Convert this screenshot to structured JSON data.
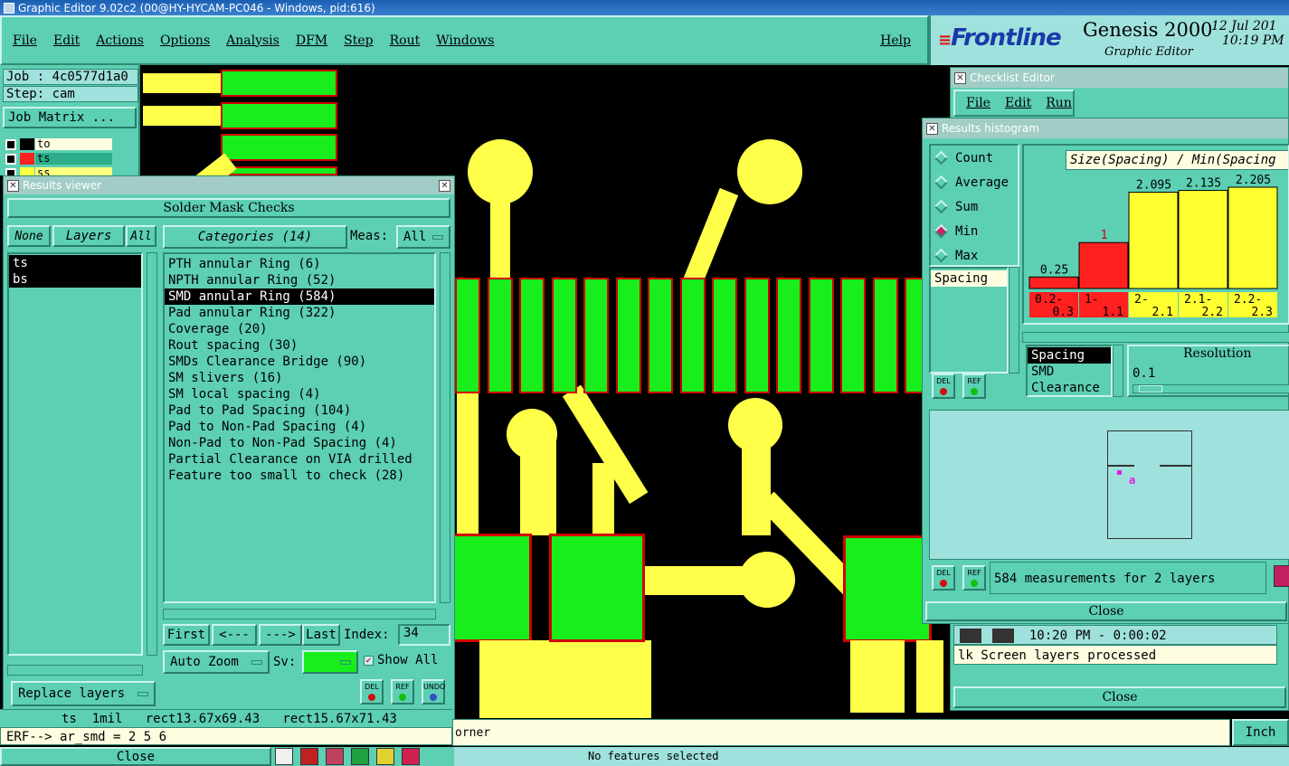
{
  "window_title": "Graphic Editor 9.02c2 (00@HY-HYCAM-PC046 - Windows, pid:616)",
  "menu": [
    "File",
    "Edit",
    "Actions",
    "Options",
    "Analysis",
    "DFM",
    "Step",
    "Rout",
    "Windows"
  ],
  "help": "Help",
  "brand": {
    "logo": "Frontline",
    "product": "Genesis 2000",
    "subtitle": "Graphic Editor",
    "date": "12 Jul 201",
    "time": "10:19 PM"
  },
  "job": {
    "job_label": "Job : 4c0577d1a0",
    "step_label": "Step: cam",
    "job_matrix": "Job Matrix ..."
  },
  "layers": [
    {
      "name": "to"
    },
    {
      "name": "ts"
    },
    {
      "name": "ss"
    }
  ],
  "results_viewer": {
    "title": "Results viewer",
    "header": "Solder Mask Checks",
    "none": "None",
    "layers": "Layers",
    "all": "All",
    "categories_label": "Categories (14)",
    "meas_label": "Meas:",
    "meas_value": "All",
    "layer_list": [
      "ts",
      "bs"
    ],
    "categories": [
      "PTH annular Ring (6)",
      "NPTH annular Ring (52)",
      "SMD annular Ring (584)",
      "Pad annular Ring (322)",
      "Coverage (20)",
      "Rout spacing (30)",
      "SMDs Clearance Bridge (90)",
      "SM slivers (16)",
      "SM local spacing (4)",
      "Pad to Pad Spacing (104)",
      "Pad to Non-Pad Spacing (4)",
      "Non-Pad to Non-Pad Spacing (4)",
      "Partial Clearance on VIA drilled",
      "Feature too small to check (28)"
    ],
    "first": "First",
    "prev": "<---",
    "next": "--->",
    "last": "Last",
    "index_label": "Index:",
    "index_value": "34",
    "auto_zoom": "Auto Zoom",
    "sv_label": "Sv:",
    "show_all": "Show All",
    "replace_layers": "Replace layers",
    "del": "DEL",
    "ref": "REF",
    "undo": "UNDO"
  },
  "status": {
    "line1": "ts  1mil   rect13.67x69.43   rect15.67x71.43",
    "erf": "ERF--> ar_smd = 2 5 6",
    "close": "Close",
    "corner": "orner",
    "no_features": "No features selected",
    "unit": "Inch"
  },
  "checklist_editor": {
    "title": "Checklist Editor",
    "menu": [
      "File",
      "Edit",
      "Run"
    ],
    "time": "10:20 PM - 0:00:02",
    "log": "lk Screen layers processed",
    "close": "Close"
  },
  "histogram": {
    "title": "Results histogram",
    "modes": [
      "Count",
      "Average",
      "Sum",
      "Min",
      "Max"
    ],
    "selected_mode": "Min",
    "measure_list": [
      "Spacing"
    ],
    "type_list": [
      "Spacing",
      "SMD",
      "Clearance"
    ],
    "resolution_label": "Resolution",
    "resolution_value": "0.1",
    "summary": "584 measurements for 2 layers",
    "close": "Close"
  },
  "chart_data": {
    "type": "bar",
    "title": "Size(Spacing) / Min(Spacing",
    "categories": [
      "0.2-0.3",
      "1-1.1",
      "2-2.1",
      "2.1-2.2",
      "2.2-2.3"
    ],
    "values": [
      0.25,
      1,
      2.095,
      2.135,
      2.205
    ],
    "labels": [
      "0.25",
      "1",
      "2.095",
      "2.135",
      "2.205"
    ],
    "colors": [
      "#ff2020",
      "#ff2020",
      "#ffff30",
      "#ffff30",
      "#ffff30"
    ]
  }
}
